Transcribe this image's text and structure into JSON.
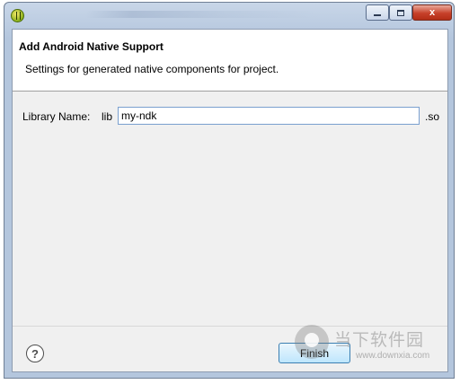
{
  "window": {
    "close_glyph": "x",
    "icon": "eclipse-logo-icon"
  },
  "header": {
    "title": "Add Android Native Support",
    "description": "Settings for generated native components for project."
  },
  "form": {
    "library_label": "Library Name:",
    "prefix": "lib",
    "library_value": "my-ndk",
    "suffix": ".so"
  },
  "footer": {
    "help_glyph": "?",
    "finish_label": "Finish"
  },
  "watermark": {
    "cn_text": "当下软件园",
    "url": "www.downxia.com"
  }
}
